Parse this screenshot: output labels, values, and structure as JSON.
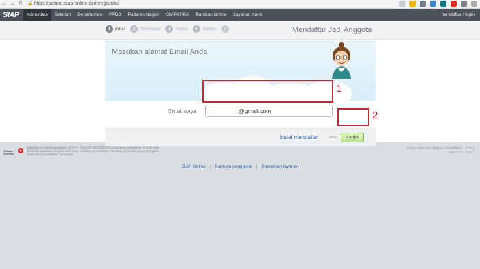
{
  "browser": {
    "url": "https://paspor.siap-online.com/registrasi",
    "back": "←",
    "forward": "→",
    "reload": "C"
  },
  "topnav": {
    "logo": "SIAP",
    "items": [
      "Komunitas",
      "Sekolah",
      "Departemen",
      "PPDB",
      "Padamu Negeri",
      "SIMPATIKA",
      "Bantuan Online",
      "Layanan Kami"
    ],
    "user": "mendaftar / login"
  },
  "steps": [
    {
      "num": "1",
      "label": "Email"
    },
    {
      "num": "2",
      "label": "Perkenalan"
    },
    {
      "num": "3",
      "label": "Profesi"
    },
    {
      "num": "4",
      "label": "Validasi"
    }
  ],
  "step_done": "✓",
  "form": {
    "heading": "Mendaftar Jadi Anggota",
    "subtitle": "Masukan alamat Email Anda",
    "email_label": "Email saya",
    "email_value": "________@gmail.com",
    "cancel": "batal mendaftar",
    "or": "atau",
    "next": "Lanjut"
  },
  "markers": [
    "1",
    "2"
  ],
  "footer": {
    "logo": "Telkom Indonesia",
    "small_text": "Layanan ini diselenggarakan oleh PT. TELKOM INDONESIA untuk buka pendidikan di Indonesia. Baik kita wujudkan bangsa Indonesia, melalui pencerdasan Teknologi Informasi yang tepat guna pada dunia pendidikan Indonesia.",
    "right_line1": "Sistem Informasi Aplikasi Pendidikan",
    "right_line2": "versi 2.0",
    "badge": "SIAP",
    "links": [
      "SIAP Online",
      "Bantuan pengguna",
      "Ketentuan layanan"
    ]
  },
  "colors": {
    "accent": "#3d6fae",
    "marker": "#c8232c",
    "nav_bg": "#4b5259"
  }
}
